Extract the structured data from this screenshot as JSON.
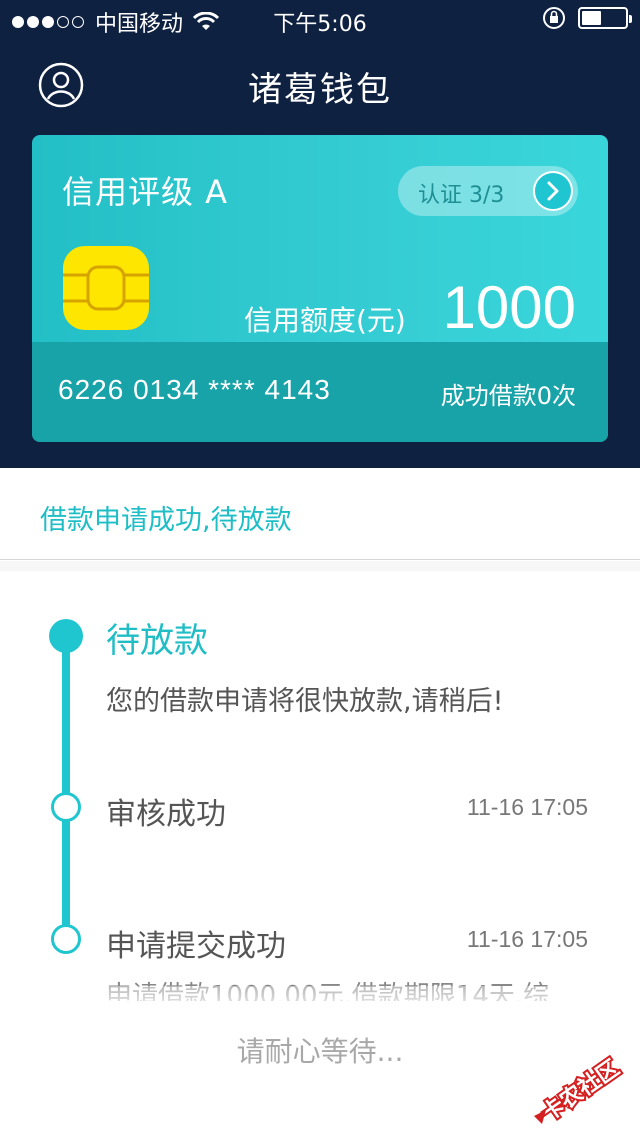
{
  "status_bar": {
    "carrier": "中国移动",
    "time": "下午5:06"
  },
  "nav": {
    "title": "诸葛钱包"
  },
  "card": {
    "credit_rating": "信用评级 A",
    "certification": "认证 3/3",
    "limit_label": "信用额度(元)",
    "limit_value": "1000",
    "card_number": "6226 0134 **** 4143",
    "loan_count": "成功借款0次"
  },
  "banner": {
    "status": "借款申请成功,待放款"
  },
  "timeline": {
    "steps": [
      {
        "title": "待放款",
        "description": "您的借款申请将很快放款,请稍后!"
      },
      {
        "title": "审核成功",
        "time": "11-16 17:05"
      },
      {
        "title": "申请提交成功",
        "time": "11-16 17:05",
        "detail": "申请借款1000.00元,借款期限14天,综"
      }
    ]
  },
  "footer": {
    "wait_text": "请耐心等待..."
  },
  "watermark": {
    "text": "卡农社区"
  },
  "icons": {
    "avatar": "user-circle-icon",
    "wifi": "wifi-icon",
    "lock": "rotation-lock-icon",
    "battery": "battery-icon",
    "arrow": "chevron-right-icon",
    "chip": "card-chip-icon"
  },
  "colors": {
    "header_bg": "#0f2141",
    "accent": "#1fc6cf",
    "card_gradient_start": "#23bfc6",
    "card_bottom": "#18a3a9",
    "chip_yellow": "#ffe600"
  },
  "battery_level": 0.45
}
